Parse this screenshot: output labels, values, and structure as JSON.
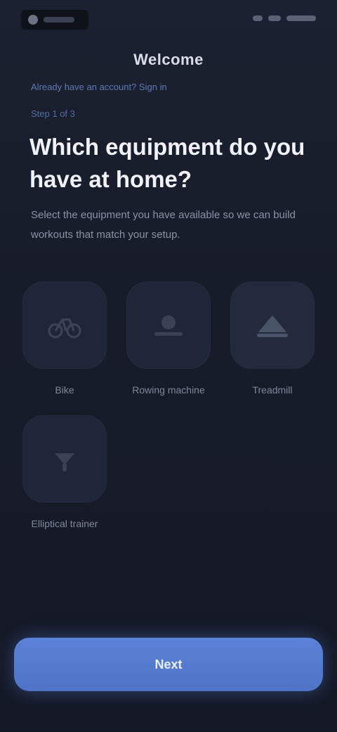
{
  "header": {
    "title": "Welcome",
    "link": "Already have an account? Sign in"
  },
  "intro": {
    "eyebrow": "Step 1 of 3",
    "headline": "Which equipment do you have at home?",
    "subtext": "Select the equipment you have available so we can build workouts that match your setup."
  },
  "options": [
    {
      "label": "Bike",
      "icon": "bike-icon"
    },
    {
      "label": "Rowing machine",
      "icon": "rowing-icon"
    },
    {
      "label": "Treadmill",
      "icon": "treadmill-icon"
    },
    {
      "label": "Elliptical trainer",
      "icon": "elliptical-icon"
    }
  ],
  "cta": {
    "label": "Next"
  },
  "colors": {
    "background": "#161b28",
    "tile": "#1f2637",
    "accent": "#5b82d6",
    "muted_text": "#8a92a6"
  }
}
